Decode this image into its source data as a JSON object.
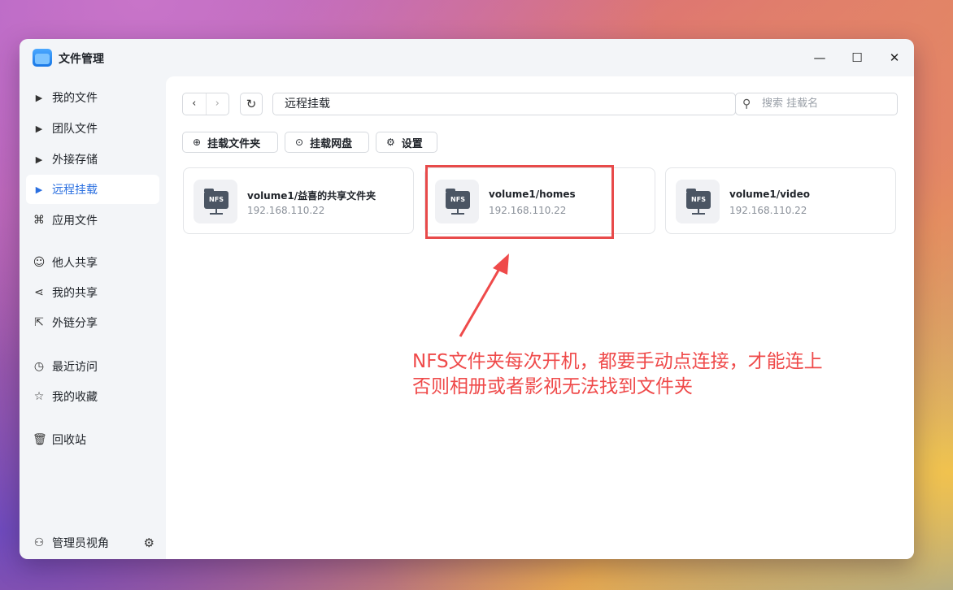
{
  "window": {
    "title": "文件管理",
    "controls": {
      "minimize": "—",
      "maximize": "☐",
      "close": "✕"
    }
  },
  "sidebar": {
    "items": [
      {
        "label": "我的文件",
        "icon": "▶"
      },
      {
        "label": "团队文件",
        "icon": "▶"
      },
      {
        "label": "外接存储",
        "icon": "▶"
      },
      {
        "label": "远程挂载",
        "icon": "▶",
        "active": true
      },
      {
        "label": "应用文件",
        "icon": "⌘"
      },
      {
        "label": "他人共享",
        "icon": "☺"
      },
      {
        "label": "我的共享",
        "icon": "⋖"
      },
      {
        "label": "外链分享",
        "icon": "⇱"
      },
      {
        "label": "最近访问",
        "icon": "◷"
      },
      {
        "label": "我的收藏",
        "icon": "☆"
      },
      {
        "label": "回收站",
        "icon": "🗑"
      }
    ],
    "footer": {
      "label": "管理员视角",
      "icon": "⚇",
      "settings_icon": "⚙"
    }
  },
  "navigation": {
    "back_icon": "‹",
    "forward_icon": "›",
    "refresh_icon": "↻"
  },
  "path": {
    "value": "远程挂载"
  },
  "search": {
    "placeholder": "搜索 挂载名",
    "icon": "⚲"
  },
  "toolbar": {
    "mount_folder": {
      "label": "挂载文件夹",
      "icon": "⊕"
    },
    "mount_disk": {
      "label": "挂载网盘",
      "icon": "⊙"
    },
    "settings": {
      "label": "设置",
      "icon": "⚙"
    }
  },
  "mounts": [
    {
      "name": "volume1/益喜的共享文件夹",
      "ip": "192.168.110.22",
      "badge": "NFS"
    },
    {
      "name": "volume1/homes",
      "ip": "192.168.110.22",
      "badge": "NFS"
    },
    {
      "name": "volume1/video",
      "ip": "192.168.110.22",
      "badge": "NFS"
    }
  ],
  "annotation": {
    "line1": "NFS文件夹每次开机，都要手动点连接，才能连上",
    "line2": "否则相册或者影视无法找到文件夹",
    "color": "#ef4a4a"
  }
}
